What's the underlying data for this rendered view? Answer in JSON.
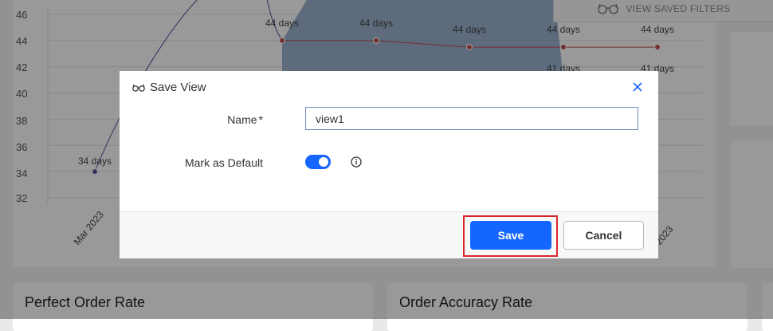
{
  "chart": {
    "y_ticks": [
      "46",
      "44",
      "42",
      "40",
      "38",
      "36",
      "34",
      "32"
    ],
    "x_labels": [
      "Mar 2023",
      "2023"
    ],
    "point_labels": [
      "34 days",
      "44 days",
      "44 days",
      "44 days",
      "44 days",
      "44 days",
      "41 days",
      "41 days"
    ]
  },
  "chart_data": {
    "type": "line",
    "ylim": [
      31,
      47
    ],
    "series": [
      {
        "values": [
          34,
          48,
          44,
          44,
          44,
          44,
          44
        ]
      },
      {
        "values": [
          41,
          41
        ]
      }
    ]
  },
  "header": {
    "filters_label": "VIEW SAVED FILTERS"
  },
  "cards": {
    "perfect_order_title": "Perfect Order Rate",
    "order_accuracy_title": "Order Accuracy Rate"
  },
  "dialog": {
    "title": "Save View",
    "name_label": "Name",
    "required_mark": "*",
    "name_value": "view1",
    "default_label": "Mark as Default",
    "default_checked": true,
    "save_label": "Save",
    "cancel_label": "Cancel"
  },
  "colors": {
    "accent": "#1565ff",
    "highlight": "#d9262c",
    "line_red": "#c44a4a",
    "line_purple": "#5b4a9c",
    "area_blue": "#8aa6c8"
  }
}
